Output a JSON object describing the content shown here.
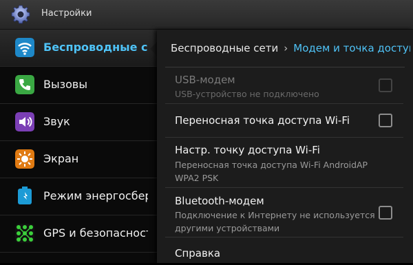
{
  "app": {
    "title": "Настройки",
    "icon": "gear-icon"
  },
  "sidebar": {
    "items": [
      {
        "label": "Беспроводные сети",
        "icon": "wifi-icon",
        "selected": true
      },
      {
        "label": "Вызовы",
        "icon": "phone-icon",
        "selected": false
      },
      {
        "label": "Звук",
        "icon": "speaker-icon",
        "selected": false
      },
      {
        "label": "Экран",
        "icon": "brightness-icon",
        "selected": false
      },
      {
        "label": "Режим энергосбережения",
        "icon": "power-saving-icon",
        "selected": false
      },
      {
        "label": "GPS и безопасность",
        "icon": "location-grid-icon",
        "selected": false
      }
    ]
  },
  "breadcrumb": {
    "parent": "Беспроводные сети",
    "separator": "›",
    "current": "Модем и точка доступа"
  },
  "settings": [
    {
      "title": "USB-модем",
      "subtitle": "USB-устройство не подключено",
      "checkbox": true,
      "checked": false,
      "enabled": false
    },
    {
      "title": "Переносная точка доступа Wi-Fi",
      "subtitle": "",
      "checkbox": true,
      "checked": false,
      "enabled": true
    },
    {
      "title": "Настр. точку доступа Wi-Fi",
      "subtitle": "Переносная точка доступа Wi-Fi AndroidAP WPA2 PSK",
      "checkbox": false,
      "enabled": true
    },
    {
      "title": "Bluetooth-модем",
      "subtitle": "Подключение к Интернету не используется другими устройствами",
      "checkbox": true,
      "checked": false,
      "enabled": true
    },
    {
      "title": "Справка",
      "subtitle": "",
      "checkbox": false,
      "enabled": true
    }
  ],
  "colors": {
    "accent": "#4fc3f7",
    "background": "#000000",
    "panel": "#1c1c1c"
  }
}
